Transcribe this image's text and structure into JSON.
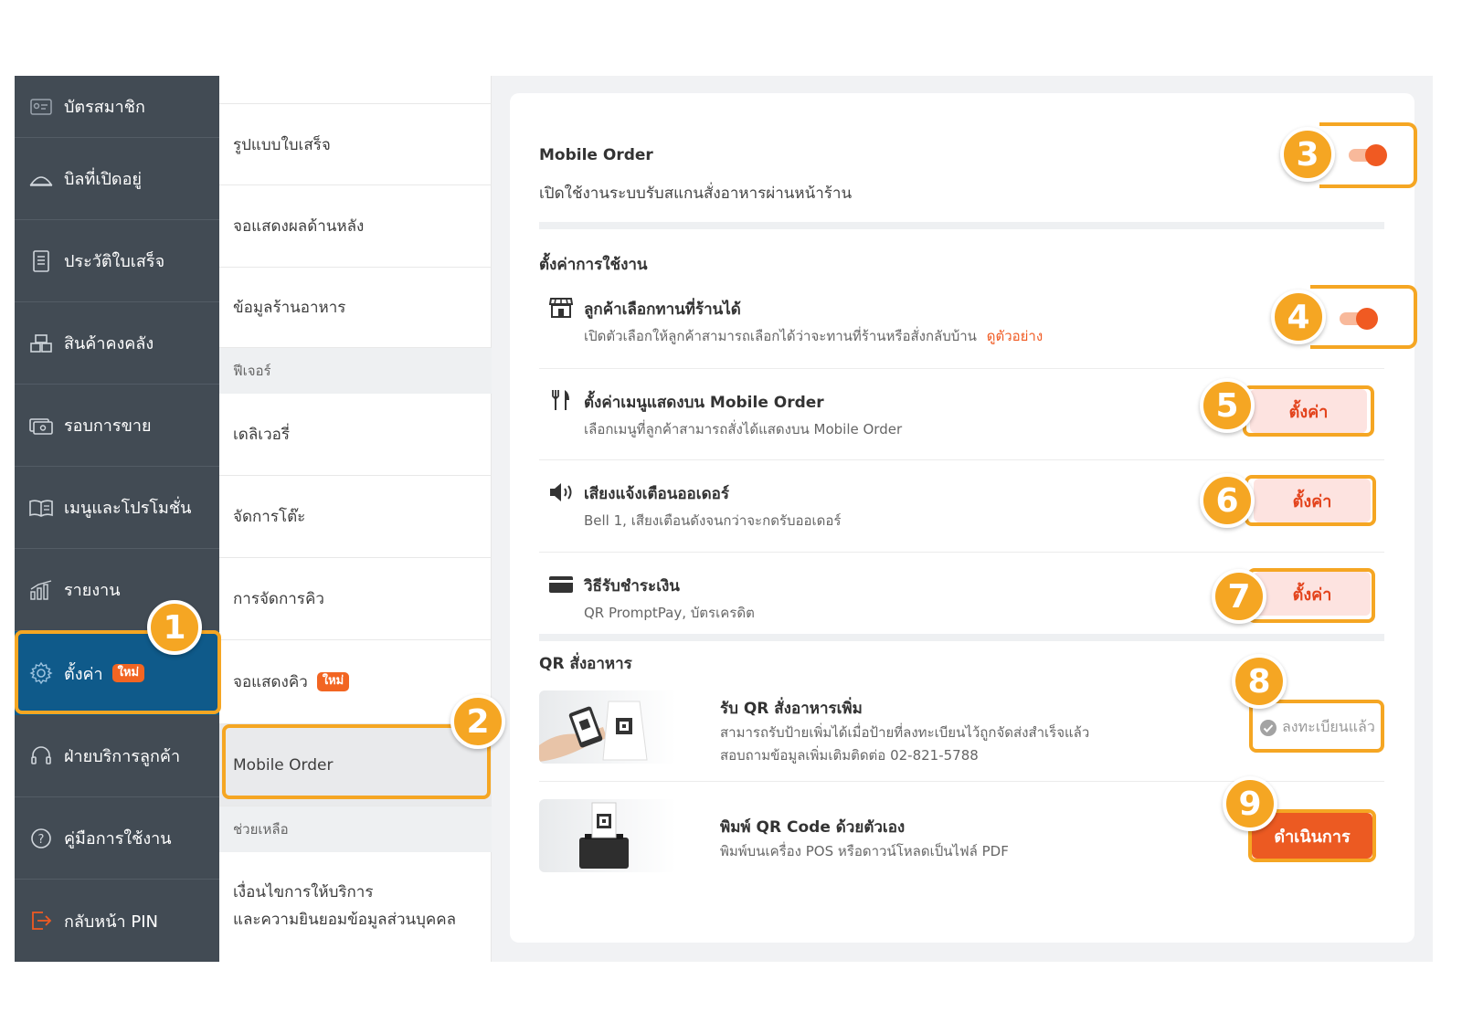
{
  "sidebar": {
    "items": [
      {
        "label": "บัตรสมาชิก",
        "icon": "member-card-icon"
      },
      {
        "label": "บิลที่เปิดอยู่",
        "icon": "open-bills-icon"
      },
      {
        "label": "ประวัติใบเสร็จ",
        "icon": "receipt-history-icon"
      },
      {
        "label": "สินค้าคงคลัง",
        "icon": "inventory-icon"
      },
      {
        "label": "รอบการขาย",
        "icon": "sales-round-icon"
      },
      {
        "label": "เมนูและโปรโมชั่น",
        "icon": "menu-book-icon"
      },
      {
        "label": "รายงาน",
        "icon": "report-chart-icon"
      },
      {
        "label": "ตั้งค่า",
        "icon": "gear-icon",
        "badge": "ใหม่",
        "active": true
      },
      {
        "label": "ฝ่ายบริการลูกค้า",
        "icon": "headset-icon"
      },
      {
        "label": "คู่มือการใช้งาน",
        "icon": "help-icon"
      },
      {
        "label": "กลับหน้า PIN",
        "icon": "logout-icon"
      }
    ]
  },
  "submenu": {
    "items": [
      {
        "label": "รูปแบบใบเสร็จ"
      },
      {
        "label": "จอแสดงผลด้านหลัง"
      },
      {
        "label": "ข้อมูลร้านอาหาร"
      }
    ],
    "features_header": "ฟีเจอร์",
    "features": [
      {
        "label": "เดลิเวอรี่"
      },
      {
        "label": "จัดการโต๊ะ"
      },
      {
        "label": "การจัดการคิว"
      },
      {
        "label": "จอแสดงคิว",
        "badge": "ใหม่"
      },
      {
        "label": "Mobile Order",
        "selected": true
      }
    ],
    "help_header": "ช่วยเหลือ",
    "help_line1": "เงื่อนไขการให้บริการ",
    "help_line2": "และความยินยอมข้อมูลส่วนบุคคล"
  },
  "main": {
    "mobile_order": {
      "title": "Mobile Order",
      "description": "เปิดใช้งานระบบรับสแกนสั่งอาหารผ่านหน้าร้าน",
      "enabled": true
    },
    "usage_settings_title": "ตั้งค่าการใช้งาน",
    "rows": [
      {
        "icon": "storefront-icon",
        "title": "ลูกค้าเลือกทานที่ร้านได้",
        "subtitle": "เปิดตัวเลือกให้ลูกค้าสามารถเลือกได้ว่าจะทานที่ร้านหรือสั่งกลับบ้าน",
        "link": "ดูตัวอย่าง",
        "control": "toggle",
        "enabled": true
      },
      {
        "icon": "fork-knife-icon",
        "title": "ตั้งค่าเมนูแสดงบน Mobile Order",
        "subtitle": "เลือกเมนูที่ลูกค้าสามารถสั่งได้แสดงบน Mobile Order",
        "button": "ตั้งค่า"
      },
      {
        "icon": "speaker-icon",
        "title": "เสียงแจ้งเตือนออเดอร์",
        "subtitle": "Bell 1, เสียงเตือนดังจนกว่าจะกดรับออเดอร์",
        "button": "ตั้งค่า"
      },
      {
        "icon": "credit-card-icon",
        "title": "วิธีรับชำระเงิน",
        "subtitle": "QR PromptPay, บัตรเครดิต",
        "button": "ตั้งค่า"
      }
    ],
    "qr_section_title": "QR สั่งอาหาร",
    "qr_rows": [
      {
        "title": "รับ QR สั่งอาหารเพิ่ม",
        "line1": "สามารถรับป้ายเพิ่มได้เมื่อป้ายที่ลงทะเบียนไว้ถูกจัดส่งสำเร็จแล้ว",
        "line2": "สอบถามข้อมูลเพิ่มเติมติดต่อ 02-821-5788",
        "status": "ลงทะเบียนแล้ว"
      },
      {
        "title": "พิมพ์ QR Code ด้วยตัวเอง",
        "line1": "พิมพ์บนเครื่อง POS หรือดาวน์โหลดเป็นไฟล์ PDF",
        "button": "ดำเนินการ"
      }
    ]
  },
  "annotations": [
    "1",
    "2",
    "3",
    "4",
    "5",
    "6",
    "7",
    "8",
    "9"
  ],
  "colors": {
    "sidebar_bg": "#424b54",
    "active_bg": "#0f5a8a",
    "accent": "#f05a22",
    "annotation": "#f5a623",
    "setting_btn_bg": "#fde3e0"
  }
}
